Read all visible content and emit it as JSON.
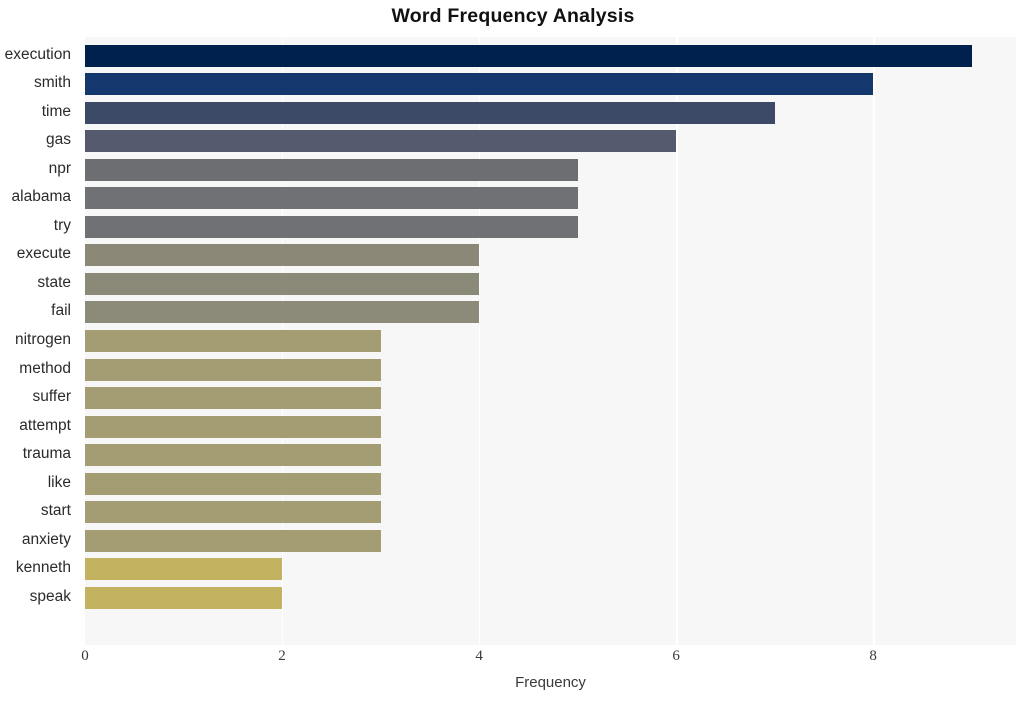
{
  "chart_data": {
    "type": "bar",
    "orientation": "horizontal",
    "title": "Word Frequency Analysis",
    "xlabel": "Frequency",
    "ylabel": "",
    "xlim": [
      0,
      9.45
    ],
    "xticks": [
      0,
      2,
      4,
      6,
      8
    ],
    "xtick_labels": [
      "0",
      "2",
      "4",
      "6",
      "8"
    ],
    "grid": true,
    "grid_axis": "x",
    "grid_color": "#ffffff",
    "plot_background": "#f7f7f7",
    "figure_background": "#ffffff",
    "legend": null,
    "categories": [
      "execution",
      "smith",
      "time",
      "gas",
      "npr",
      "alabama",
      "try",
      "execute",
      "state",
      "fail",
      "nitrogen",
      "method",
      "suffer",
      "attempt",
      "trauma",
      "like",
      "start",
      "anxiety",
      "kenneth",
      "speak"
    ],
    "values": [
      9,
      8,
      7,
      6,
      5,
      5,
      5,
      4,
      4,
      4,
      3,
      3,
      3,
      3,
      3,
      3,
      3,
      3,
      2,
      2
    ],
    "bar_colors": [
      "#00204d",
      "#14376e",
      "#3c4a68",
      "#565a6e",
      "#6c6e72",
      "#6f7174",
      "#6f7174",
      "#8b8877",
      "#8b8a78",
      "#8c8a79",
      "#a49c72",
      "#a49c72",
      "#a49c72",
      "#a49c72",
      "#a49c72",
      "#a49c72",
      "#a49c72",
      "#a49c72",
      "#c3b25f",
      "#c3b25f"
    ],
    "colormap": "cividis",
    "bars": [
      {
        "label": "execution",
        "value": 9,
        "color": "#00204d"
      },
      {
        "label": "smith",
        "value": 8,
        "color": "#14376e"
      },
      {
        "label": "time",
        "value": 7,
        "color": "#3c4a68"
      },
      {
        "label": "gas",
        "value": 6,
        "color": "#565a6e"
      },
      {
        "label": "npr",
        "value": 5,
        "color": "#6c6e72"
      },
      {
        "label": "alabama",
        "value": 5,
        "color": "#6f7174"
      },
      {
        "label": "try",
        "value": 5,
        "color": "#6f7174"
      },
      {
        "label": "execute",
        "value": 4,
        "color": "#8b8877"
      },
      {
        "label": "state",
        "value": 4,
        "color": "#8b8a78"
      },
      {
        "label": "fail",
        "value": 4,
        "color": "#8c8a79"
      },
      {
        "label": "nitrogen",
        "value": 3,
        "color": "#a49c72"
      },
      {
        "label": "method",
        "value": 3,
        "color": "#a49c72"
      },
      {
        "label": "suffer",
        "value": 3,
        "color": "#a49c72"
      },
      {
        "label": "attempt",
        "value": 3,
        "color": "#a49c72"
      },
      {
        "label": "trauma",
        "value": 3,
        "color": "#a49c72"
      },
      {
        "label": "like",
        "value": 3,
        "color": "#a49c72"
      },
      {
        "label": "start",
        "value": 3,
        "color": "#a49c72"
      },
      {
        "label": "anxiety",
        "value": 3,
        "color": "#a49c72"
      },
      {
        "label": "kenneth",
        "value": 2,
        "color": "#c3b25f"
      },
      {
        "label": "speak",
        "value": 2,
        "color": "#c3b25f"
      }
    ]
  }
}
